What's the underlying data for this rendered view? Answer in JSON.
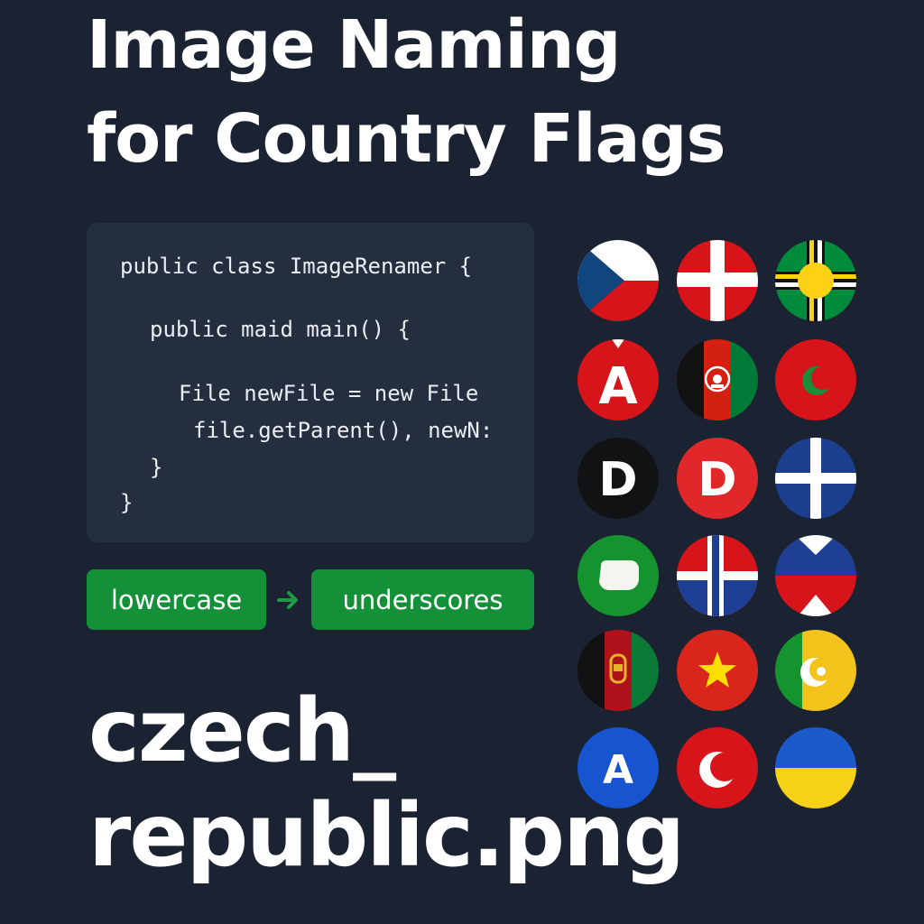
{
  "title": {
    "line1": "Image Naming",
    "line2": "for Country Flags"
  },
  "code": {
    "lines": [
      "public class ImageRenamer {",
      "public maid main() {",
      "File newFile = new File",
      "file.getParent(), newN:",
      "}",
      "}"
    ]
  },
  "steps": {
    "first": "lowercase",
    "second": "underscores"
  },
  "filename": {
    "line1": "czech_",
    "line2": "republic.png"
  },
  "flags": [
    {
      "id": "czech-republic",
      "glyph": ""
    },
    {
      "id": "denmark-cross",
      "glyph": ""
    },
    {
      "id": "yellow-circle-cross",
      "glyph": ""
    },
    {
      "id": "red-letter-a",
      "glyph": "A"
    },
    {
      "id": "afghanistan",
      "glyph": ""
    },
    {
      "id": "red-green-crescent",
      "glyph": ""
    },
    {
      "id": "black-letter-d",
      "glyph": "D"
    },
    {
      "id": "red-letter-d",
      "glyph": "D"
    },
    {
      "id": "blue-white-cross",
      "glyph": ""
    },
    {
      "id": "green-white-oval",
      "glyph": ""
    },
    {
      "id": "norway-cross",
      "glyph": ""
    },
    {
      "id": "blue-red-chevron",
      "glyph": ""
    },
    {
      "id": "black-red-green-vertical",
      "glyph": ""
    },
    {
      "id": "red-yellow-star",
      "glyph": ""
    },
    {
      "id": "green-yellow-crescent",
      "glyph": ""
    },
    {
      "id": "blue-letter-a",
      "glyph": "A"
    },
    {
      "id": "red-crescent",
      "glyph": ""
    },
    {
      "id": "blue-yellow-horizontal",
      "glyph": ""
    }
  ],
  "colors": {
    "background": "#1b2232",
    "panel": "#252e3f",
    "accent_green": "#149138",
    "arrow_green": "#1f9a45"
  }
}
